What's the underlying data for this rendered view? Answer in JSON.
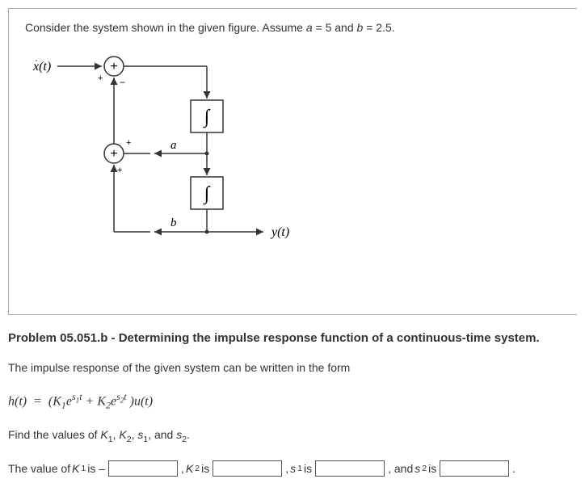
{
  "prompt": {
    "text_pre": "Consider the system shown in the given figure. Assume ",
    "a_label": "a",
    "a_eq": " = 5 and ",
    "b_label": "b",
    "b_eq": " = 2.5."
  },
  "diagram": {
    "input": "x(t)",
    "output": "y(t)",
    "plus1": "+",
    "plus2": "+",
    "sign_plus_top": "+",
    "sign_minus_top": "−",
    "sign_plus_mid": "+",
    "sign_plus_mid2": "+",
    "int": "∫",
    "a": "a",
    "b": "b"
  },
  "title": "Problem 05.051.b - Determining the impulse response function of a continuous-time system.",
  "body1": "The impulse response of the given system can be written in the form",
  "equation_html": "h(t)   =   (K<sub>1</sub>e<sup>s<sub>1</sub>t</sup> + K<sub>2</sub>e<sup>s<sub>2</sub>t</sup> )u(t)",
  "body2_pre": "Find the values of ",
  "k1": "K",
  "k1sub": "1",
  "k2": "K",
  "k2sub": "2",
  "s1": "s",
  "s1sub": "1",
  "s2": "s",
  "s2sub": "2",
  "body2_post": ".",
  "fill": {
    "pre": "The value of ",
    "k1": "K",
    "k1sub": "1",
    "is1": " is – ",
    "sep1": " , ",
    "k2": "K",
    "k2sub": "2",
    "is2": " is ",
    "sep2": " , ",
    "s1": "s",
    "s1sub": "1",
    "is3": " is ",
    "sep3": " , and ",
    "s2": "s",
    "s2sub": "2",
    "is4": " is ",
    "period": " ."
  }
}
